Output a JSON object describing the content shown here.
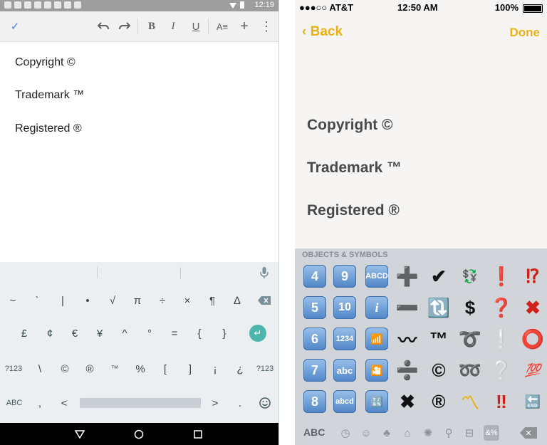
{
  "android": {
    "status_bar": {
      "time": "12:19"
    },
    "toolbar": {
      "done_icon": "checkmark-icon",
      "undo_icon": "undo-icon",
      "redo_icon": "redo-icon",
      "bold_label": "B",
      "italic_label": "I",
      "underline_label": "U",
      "format_icon": "text-format-icon",
      "insert_icon": "plus-icon",
      "more_icon": "more-vert-icon"
    },
    "document_lines": [
      "Copyright ©",
      "Trademark ™",
      "Registered ®"
    ],
    "keyboard": {
      "row1": [
        "~",
        "`",
        "|",
        "•",
        "√",
        "π",
        "÷",
        "×",
        "¶",
        "∆"
      ],
      "row2": [
        "£",
        "¢",
        "€",
        "¥",
        "^",
        "°",
        "=",
        "{",
        "}"
      ],
      "row3": [
        "?123",
        "\\",
        "©",
        "®",
        "™",
        "%",
        "[",
        "]",
        "¡",
        "¿",
        "?123"
      ],
      "row4": {
        "left": "ABC",
        "comma": ",",
        "lt": "<",
        "gt": ">",
        "period": "."
      }
    }
  },
  "ios": {
    "status_bar": {
      "carrier": "●●●○○ AT&T",
      "time": "12:50 AM",
      "battery": "100%"
    },
    "nav": {
      "back_label": "Back",
      "done_label": "Done"
    },
    "document_lines": [
      "Copyright ©",
      "Trademark ™",
      "Registered ®"
    ],
    "keyboard": {
      "title": "OBJECTS & SYMBOLS",
      "abc_label": "ABC",
      "grid": [
        [
          "4",
          "9",
          "ABCD",
          "➕",
          "✔",
          "💱",
          "❗",
          "⁉"
        ],
        [
          "5",
          "10",
          "i",
          "➖",
          "🔃",
          "$",
          "❓",
          "✖"
        ],
        [
          "6",
          "1234",
          "📶",
          "〰",
          "™",
          "➰",
          "❕",
          "⭕"
        ],
        [
          "7",
          "abc",
          "🎦",
          "➗",
          "©",
          "➿",
          "❔",
          "💯"
        ],
        [
          "8",
          "abcd",
          "🔣",
          "✖",
          "®",
          "〽",
          "‼",
          "🔚"
        ]
      ]
    }
  }
}
